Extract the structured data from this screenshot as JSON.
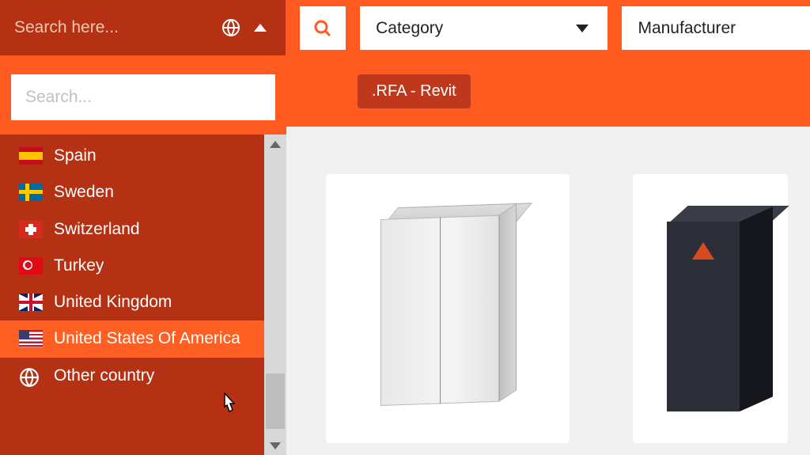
{
  "topbar": {
    "region_placeholder": "Search here...",
    "category_label": "Category",
    "manufacturer_label": "Manufacturer"
  },
  "dropdown": {
    "search_placeholder": "Search...",
    "countries": [
      {
        "label": "Spain",
        "flag_class": "flag-es",
        "hovered": false
      },
      {
        "label": "Sweden",
        "flag_class": "flag-se",
        "hovered": false
      },
      {
        "label": "Switzerland",
        "flag_class": "flag-ch",
        "hovered": false
      },
      {
        "label": "Turkey",
        "flag_class": "flag-tr",
        "hovered": false
      },
      {
        "label": "United Kingdom",
        "flag_class": "flag-gb",
        "hovered": false
      },
      {
        "label": "United States Of America",
        "flag_class": "flag-us",
        "hovered": true
      },
      {
        "label": "Other country",
        "flag_class": "globe",
        "hovered": false
      }
    ]
  },
  "chips": {
    "rfa": ".RFA - Revit"
  },
  "results": {
    "cards": [
      "cabinet",
      "tower"
    ]
  },
  "colors": {
    "orange_bright": "#ff5a1f",
    "orange_dark": "#b53114"
  }
}
